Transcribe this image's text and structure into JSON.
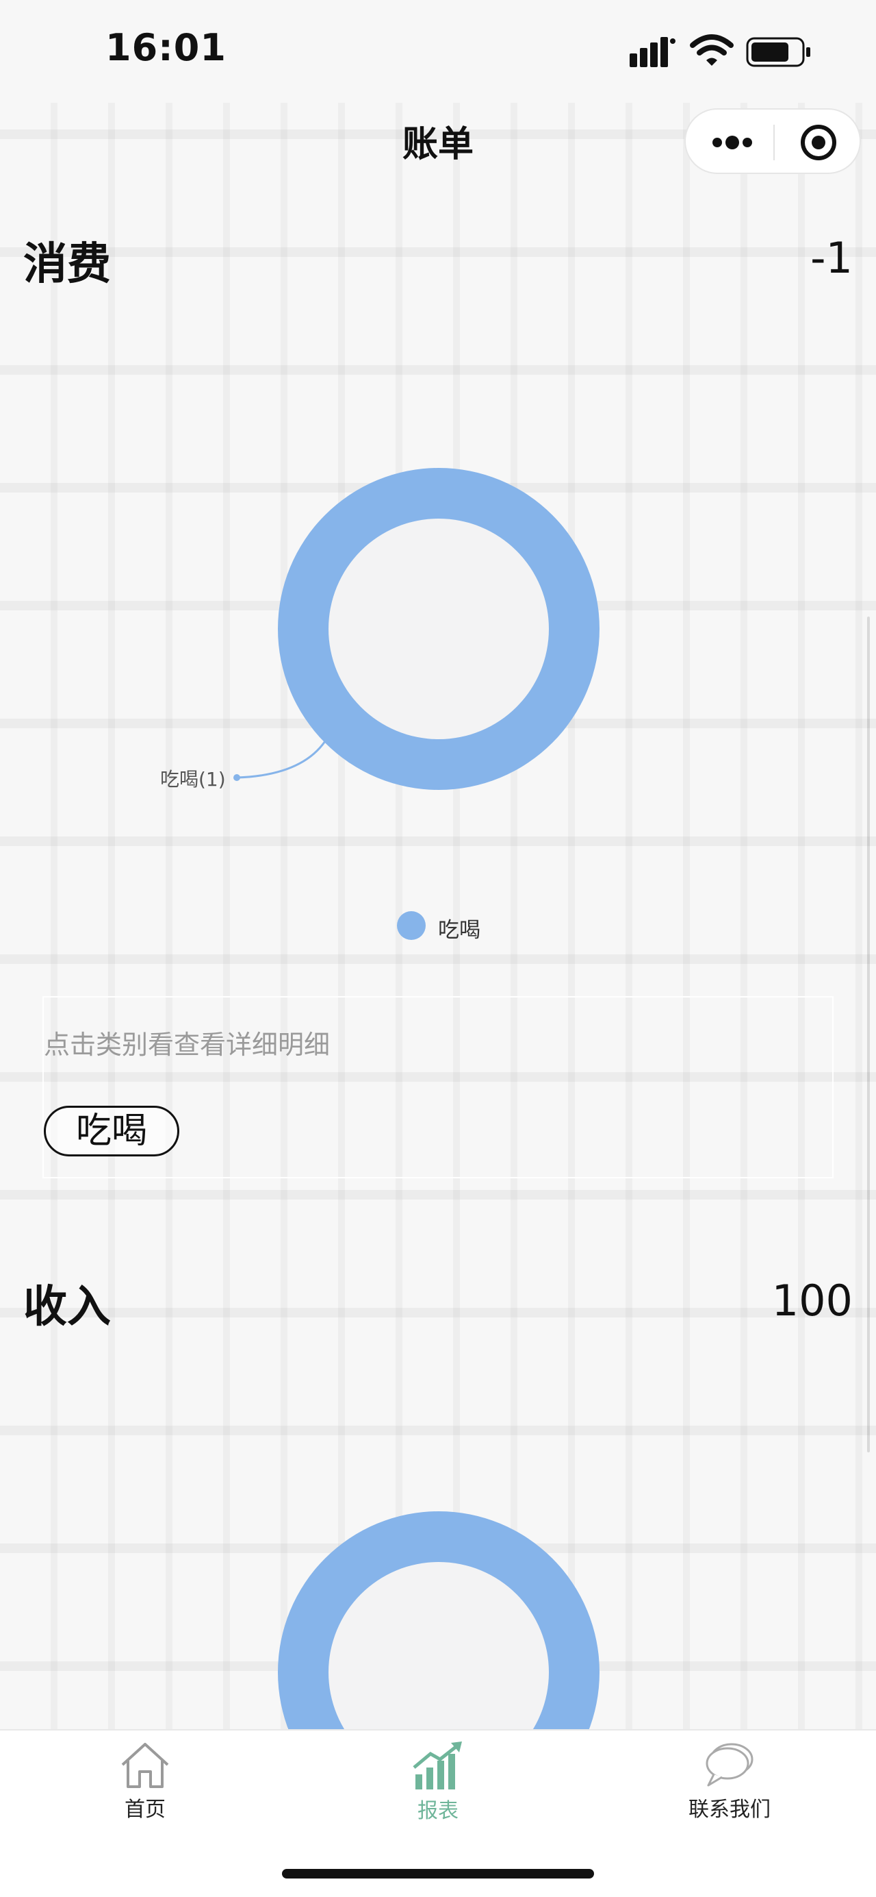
{
  "status_bar": {
    "time": "16:01"
  },
  "nav": {
    "title": "账单",
    "icons": [
      "more-icon",
      "close-target-icon"
    ]
  },
  "expense": {
    "title": "消费",
    "amount": "-1",
    "detail_hint": "点击类别看查看详细明细",
    "categories": [
      "吃喝"
    ]
  },
  "income": {
    "title": "收入",
    "amount": "100"
  },
  "chart_data": [
    {
      "type": "pie",
      "variant": "donut",
      "categories": [
        "吃喝"
      ],
      "values": [
        1
      ],
      "slice_labels": [
        "吃喝(1)"
      ],
      "legend": [
        "吃喝"
      ],
      "legend_position": "bottom",
      "colors": [
        "#86b4ea"
      ]
    },
    {
      "type": "pie",
      "variant": "donut",
      "colors": [
        "#86b4ea"
      ]
    }
  ],
  "tab_bar": {
    "items": [
      {
        "label": "首页",
        "icon": "home-icon",
        "active": false
      },
      {
        "label": "报表",
        "icon": "chart-icon",
        "active": true
      },
      {
        "label": "联系我们",
        "icon": "chat-bubble-icon",
        "active": false
      }
    ]
  },
  "colors": {
    "accent": "#86b4ea",
    "tab_active": "#6fb59a"
  }
}
